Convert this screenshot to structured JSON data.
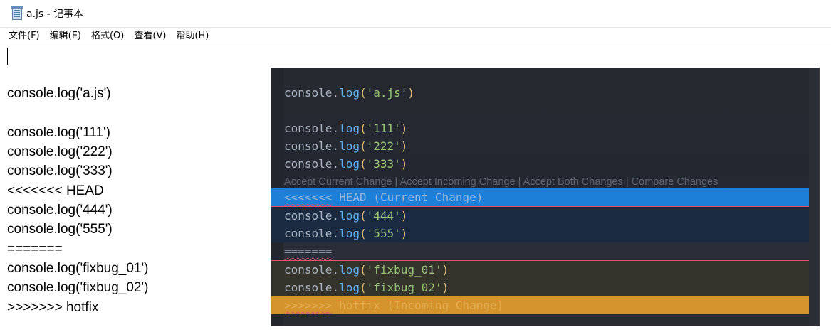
{
  "window": {
    "title": "a.js - 记事本",
    "icon": "notepad-icon"
  },
  "menu": [
    {
      "id": "file",
      "label": "文件(F)"
    },
    {
      "id": "edit",
      "label": "编辑(E)"
    },
    {
      "id": "format",
      "label": "格式(O)"
    },
    {
      "id": "view",
      "label": "查看(V)"
    },
    {
      "id": "help",
      "label": "帮助(H)"
    }
  ],
  "notepad_lines": [
    "",
    "console.log('a.js')",
    "",
    "console.log('111')",
    "console.log('222')",
    "console.log('333')",
    "<<<<<<< HEAD",
    "console.log('444')",
    "console.log('555')",
    "=======",
    "console.log('fixbug_01')",
    "console.log('fixbug_02')",
    ">>>>>>> hotfix"
  ],
  "vscode": {
    "colors": {
      "current_change": "#1e7fd8",
      "incoming_change": "#d4932b",
      "conflict_marker": "#e0506b",
      "function": "#61afef",
      "string": "#98c379",
      "paren": "#e5c07b"
    },
    "code_lines": [
      {
        "kind": "code",
        "obj": "console.",
        "fn": "log",
        "open": "(",
        "str": "'a.js'",
        "close": ")"
      },
      {
        "kind": "empty"
      },
      {
        "kind": "code",
        "obj": "console.",
        "fn": "log",
        "open": "(",
        "str": "'111'",
        "close": ")"
      },
      {
        "kind": "code",
        "obj": "console.",
        "fn": "log",
        "open": "(",
        "str": "'222'",
        "close": ")"
      },
      {
        "kind": "code",
        "obj": "console.",
        "fn": "log",
        "open": "(",
        "str": "'333'",
        "close": ")"
      },
      {
        "kind": "lens",
        "text": "Accept Current Change | Accept Incoming Change | Accept Both Changes | Compare Changes"
      },
      {
        "kind": "marker",
        "cls": "current-head",
        "marker": "<<<<<<<",
        "rest": " HEAD (Current Change)"
      },
      {
        "kind": "code",
        "cls": "current-body",
        "obj": "console.",
        "fn": "log",
        "open": "(",
        "str": "'444'",
        "close": ")"
      },
      {
        "kind": "code",
        "cls": "current-body",
        "obj": "console.",
        "fn": "log",
        "open": "(",
        "str": "'555'",
        "close": ")"
      },
      {
        "kind": "marker",
        "cls": "divider",
        "marker": "=======",
        "rest": ""
      },
      {
        "kind": "code",
        "cls": "incoming-body",
        "obj": "console.",
        "fn": "log",
        "open": "(",
        "str": "'fixbug_01'",
        "close": ")"
      },
      {
        "kind": "code",
        "cls": "incoming-body",
        "obj": "console.",
        "fn": "log",
        "open": "(",
        "str": "'fixbug_02'",
        "close": ")"
      },
      {
        "kind": "marker",
        "cls": "incoming-head",
        "marker": ">>>>>>>",
        "rest": " hotfix (Incoming Change)"
      }
    ]
  }
}
